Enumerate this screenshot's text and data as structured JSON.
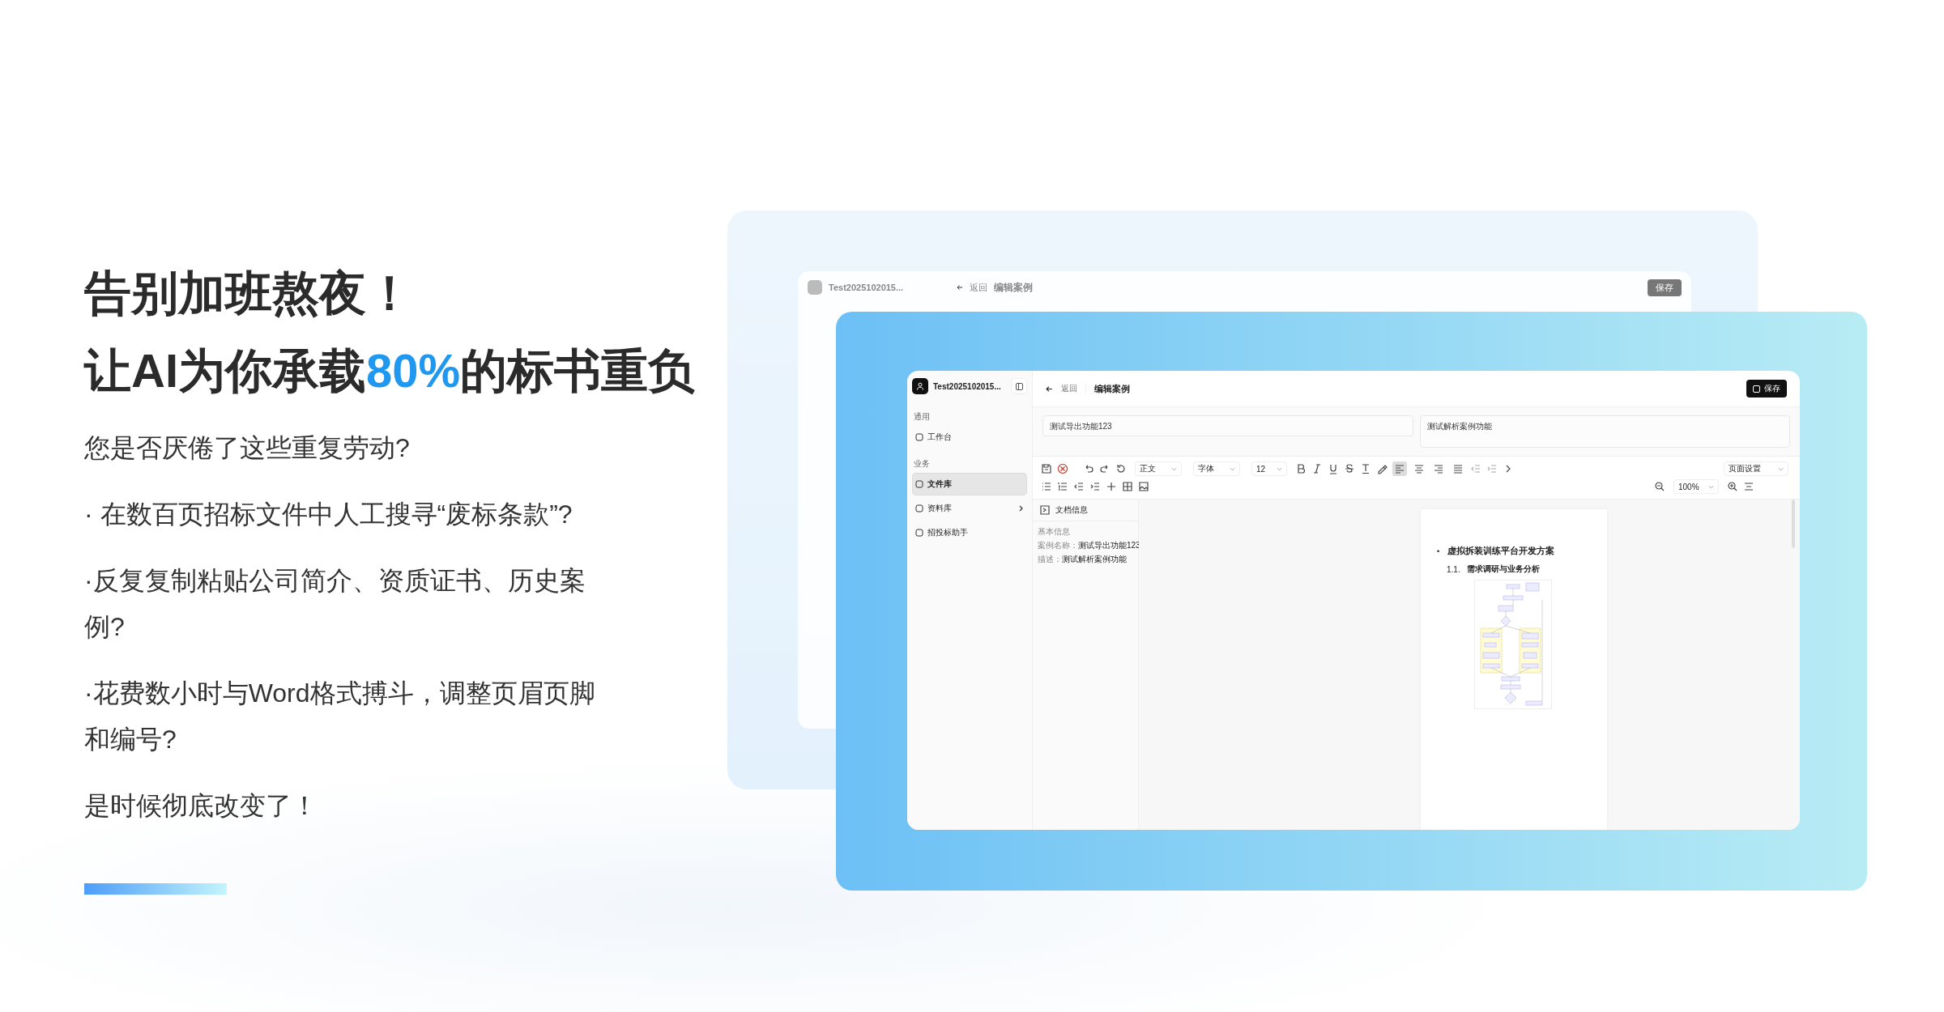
{
  "hero": {
    "title_line1": "告别加班熬夜！",
    "title_line2": "让AI为你承载**80%**的标书重负",
    "question": "您是否厌倦了这些重复劳动?",
    "bullets": [
      "· 在数百页招标文件中人工搜寻“废标条款”?",
      "·反复复制粘贴公司简介、资质证书、历史案例?",
      "·花费数小时与Word格式搏斗，调整页眉页脚和编号?"
    ],
    "closing": "是时候彻底改变了！"
  },
  "back_window": {
    "account": "Test2025102015...",
    "back": "返回",
    "page_title": "编辑案例",
    "save": "保存"
  },
  "app": {
    "account": "Test2025102015...",
    "sidebar": [
      {
        "group": "通用",
        "items": [
          {
            "label": "工作台",
            "selected": false,
            "has_submenu": false
          }
        ]
      },
      {
        "group": "业务",
        "items": [
          {
            "label": "文件库",
            "selected": true,
            "has_submenu": false
          },
          {
            "label": "资料库",
            "selected": false,
            "has_submenu": true
          },
          {
            "label": "招投标助手",
            "selected": false,
            "has_submenu": false
          }
        ]
      }
    ],
    "back": "返回",
    "page_title": "编辑案例",
    "save": "保存",
    "name_field": "测试导出功能123",
    "description_field": "测试解析案例功能",
    "toolbar": {
      "style_select": "正文",
      "font_select": "字体",
      "size_select": "12",
      "alignment": [
        {
          "selected": true
        },
        {
          "selected": false
        },
        {
          "selected": false
        },
        {
          "selected": false
        }
      ],
      "page_setup_select": "页面设置",
      "zoom_select": "100%"
    },
    "info_panel": {
      "title": "文档信息",
      "section": "基本信息",
      "fields": [
        {
          "label": "案例名称：",
          "value": "测试导出功能123"
        },
        {
          "label": "描述：",
          "value": "测试解析案例功能"
        }
      ]
    },
    "document": {
      "heading_bullet": "•",
      "heading": "虚拟拆装训练平台开发方案",
      "subheading_number": "1.1.",
      "subheading": "需求调研与业务分析"
    }
  }
}
